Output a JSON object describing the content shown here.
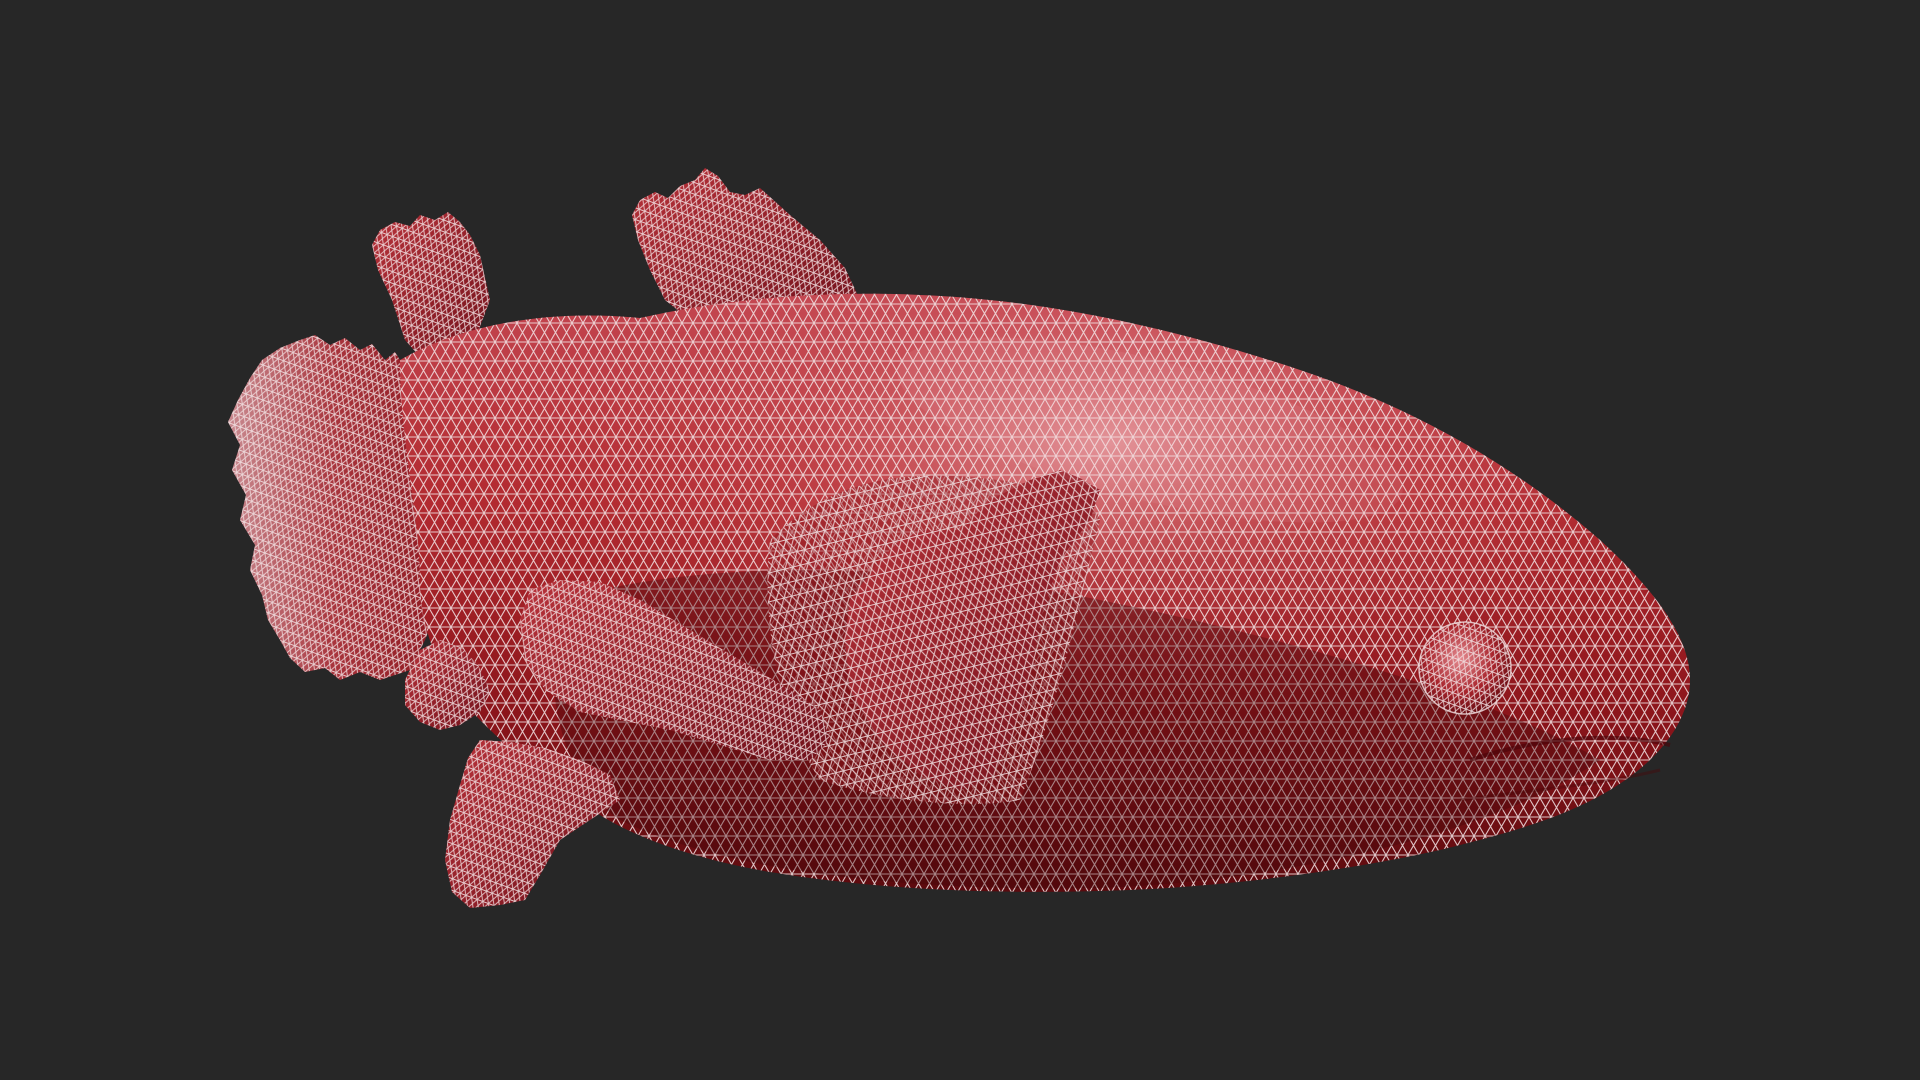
{
  "scene": {
    "background_color": "#272727",
    "subject": "coelacanth-fish-model",
    "display_mode": "wireframe-on-shaded",
    "colors": {
      "body_light": "#c0505a",
      "body_mid": "#a01e24",
      "body_dark": "#5a0a0e",
      "highlight": "#e89aa0",
      "wire": "#f2dfe0"
    },
    "icons": [
      "fish-body",
      "dorsal-fin",
      "tail-fin",
      "pectoral-fin",
      "pelvic-fin",
      "anal-fin",
      "eye"
    ]
  }
}
